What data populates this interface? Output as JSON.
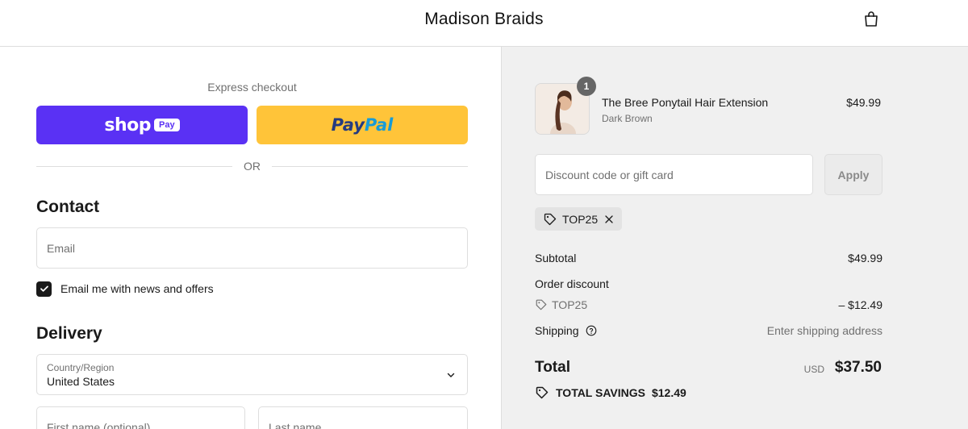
{
  "header": {
    "store_name": "Madison Braids",
    "cart_icon": "shopping-bag-icon"
  },
  "express": {
    "label": "Express checkout",
    "shop_pay": {
      "word": "shop",
      "pill": "Pay"
    },
    "paypal": {
      "part1": "Pay",
      "part2": "Pal"
    },
    "divider": "OR"
  },
  "contact": {
    "title": "Contact",
    "email_placeholder": "Email",
    "newsletter_label": "Email me with news and offers",
    "newsletter_checked": true
  },
  "delivery": {
    "title": "Delivery",
    "country_label": "Country/Region",
    "country_value": "United States",
    "first_name_placeholder": "First name (optional)",
    "last_name_placeholder": "Last name"
  },
  "order": {
    "item": {
      "name": "The Bree Ponytail Hair Extension",
      "variant": "Dark Brown",
      "price": "$49.99",
      "quantity": "1"
    },
    "discount_placeholder": "Discount code or gift card",
    "apply_label": "Apply",
    "applied_code": "TOP25",
    "subtotal_label": "Subtotal",
    "subtotal_value": "$49.99",
    "order_discount_label": "Order discount",
    "discount_code": "TOP25",
    "discount_value": "– $12.49",
    "shipping_label": "Shipping",
    "shipping_value": "Enter shipping address",
    "total_label": "Total",
    "total_currency": "USD",
    "total_value": "$37.50",
    "savings_label": "TOTAL SAVINGS",
    "savings_value": "$12.49"
  },
  "colors": {
    "shop_pay": "#5a31f4",
    "paypal": "#ffc439",
    "summary_bg": "#f0f0f0"
  }
}
